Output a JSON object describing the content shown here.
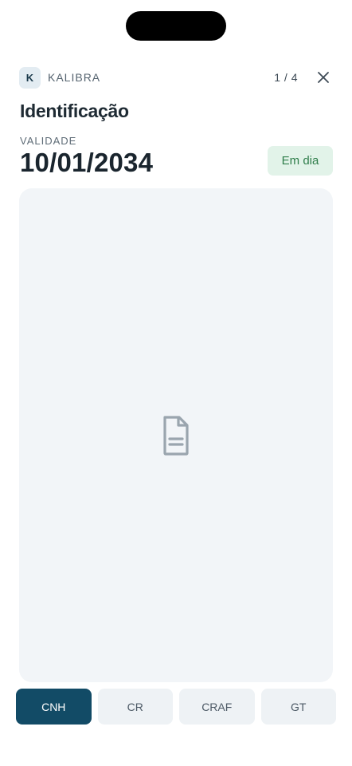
{
  "header": {
    "brand_initial": "K",
    "brand_name": "KALIBRA",
    "counter": "1 / 4",
    "close_icon": "close-icon"
  },
  "document": {
    "title": "Identificação",
    "validity_label": "VALIDADE",
    "validity_date": "10/01/2034",
    "status": "Em dia",
    "placeholder_icon": "document-icon"
  },
  "tabs": [
    {
      "label": "CNH",
      "active": true
    },
    {
      "label": "CR",
      "active": false
    },
    {
      "label": "CRAF",
      "active": false
    },
    {
      "label": "GT",
      "active": false
    }
  ],
  "colors": {
    "accent": "#124b66",
    "status_bg": "#e2f3e9",
    "status_text": "#2e7d4a"
  }
}
